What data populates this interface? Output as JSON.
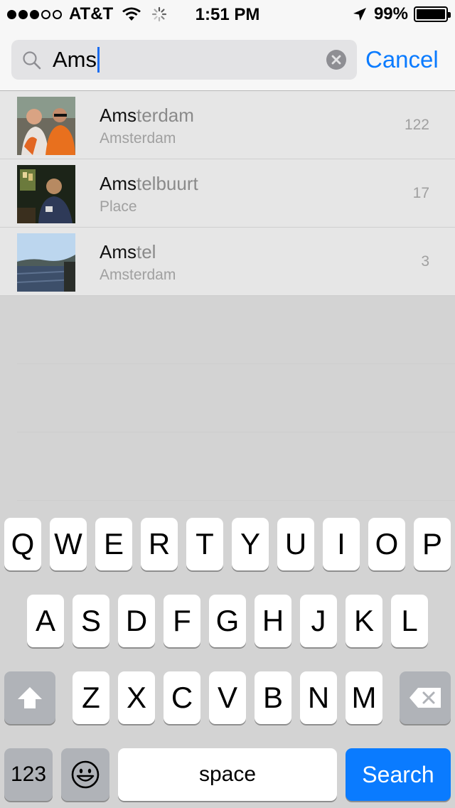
{
  "status_bar": {
    "carrier": "AT&T",
    "time": "1:51 PM",
    "battery_percent": "99%",
    "signal_bars_filled": 3,
    "signal_bars_total": 5,
    "battery_level": 0.99
  },
  "search": {
    "query": "Ams",
    "cancel_label": "Cancel"
  },
  "results": [
    {
      "title_match": "Ams",
      "title_rest": "terdam",
      "subtitle": "Amsterdam",
      "count": "122",
      "thumb": "people-orange"
    },
    {
      "title_match": "Ams",
      "title_rest": "telbuurt",
      "subtitle": "Place",
      "count": "17",
      "thumb": "night-interior"
    },
    {
      "title_match": "Ams",
      "title_rest": "tel",
      "subtitle": "Amsterdam",
      "count": "3",
      "thumb": "river-view"
    }
  ],
  "keyboard": {
    "row1": [
      "Q",
      "W",
      "E",
      "R",
      "T",
      "Y",
      "U",
      "I",
      "O",
      "P"
    ],
    "row2": [
      "A",
      "S",
      "D",
      "F",
      "G",
      "H",
      "J",
      "K",
      "L"
    ],
    "row3": [
      "Z",
      "X",
      "C",
      "V",
      "B",
      "N",
      "M"
    ],
    "numbers_label": "123",
    "space_label": "space",
    "search_label": "Search",
    "shift_icon": "shift-arrow-icon",
    "delete_icon": "backspace-icon",
    "emoji_icon": "emoji-smiley-icon"
  },
  "colors": {
    "accent": "#0a7bff",
    "caret": "#1a6cf0"
  }
}
